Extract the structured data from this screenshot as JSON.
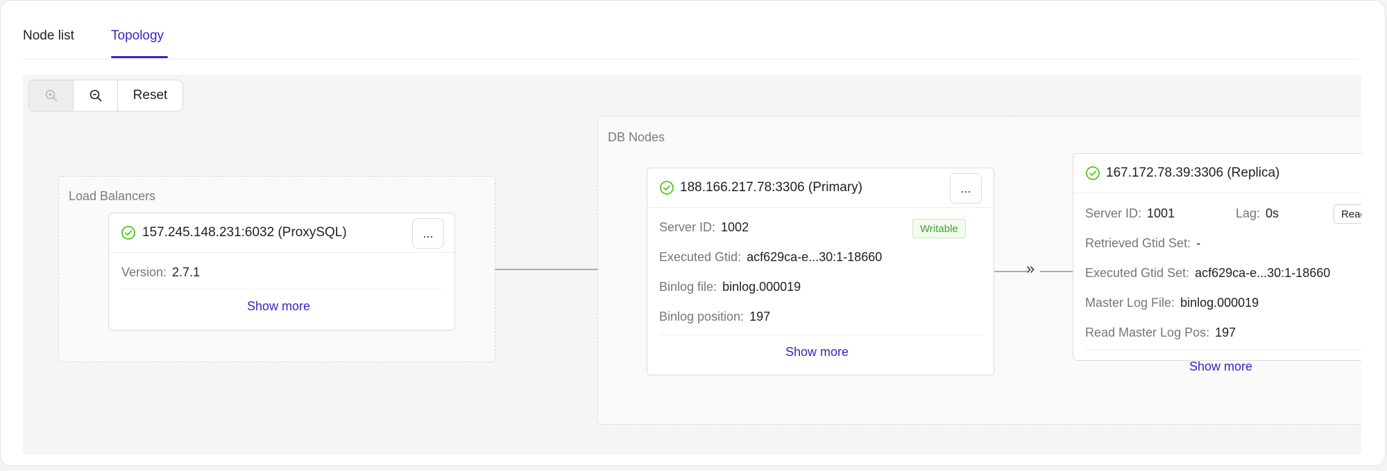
{
  "tabs": [
    {
      "label": "Node list",
      "active": false
    },
    {
      "label": "Topology",
      "active": true
    }
  ],
  "zoom": {
    "zoom_in_icon": "zoom-in-icon",
    "zoom_out_icon": "zoom-out-icon",
    "reset_label": "Reset"
  },
  "load_balancers": {
    "title": "Load Balancers",
    "node": {
      "title": "157.245.148.231:6032 (ProxySQL)",
      "more_label": "...",
      "version_label": "Version:",
      "version_value": "2.7.1",
      "show_more": "Show more"
    }
  },
  "db_nodes": {
    "title": "DB Nodes",
    "primary": {
      "title": "188.166.217.78:3306 (Primary)",
      "more_label": "...",
      "badge": "Writable",
      "server_id_label": "Server ID:",
      "server_id_value": "1002",
      "executed_gtid_label": "Executed Gtid:",
      "executed_gtid_value": "acf629ca-e...30:1-18660",
      "binlog_file_label": "Binlog file:",
      "binlog_file_value": "binlog.000019",
      "binlog_pos_label": "Binlog position:",
      "binlog_pos_value": "197",
      "show_more": "Show more"
    },
    "replica": {
      "title": "167.172.78.39:3306 (Replica)",
      "badge": "Readon",
      "server_id_label": "Server ID:",
      "server_id_value": "1001",
      "lag_label": "Lag:",
      "lag_value": "0s",
      "retrieved_gtid_label": "Retrieved Gtid Set:",
      "retrieved_gtid_value": "-",
      "executed_gtid_label": "Executed Gtid Set:",
      "executed_gtid_value": "acf629ca-e...30:1-18660",
      "master_log_file_label": "Master Log File:",
      "master_log_file_value": "binlog.000019",
      "read_master_log_pos_label": "Read Master Log Pos:",
      "read_master_log_pos_value": "197",
      "show_more": "Show more"
    },
    "replication_arrow": "»"
  },
  "colors": {
    "accent": "#3b1fc4",
    "ok_green": "#52c41a",
    "writable_green": "#3f9e2e"
  }
}
